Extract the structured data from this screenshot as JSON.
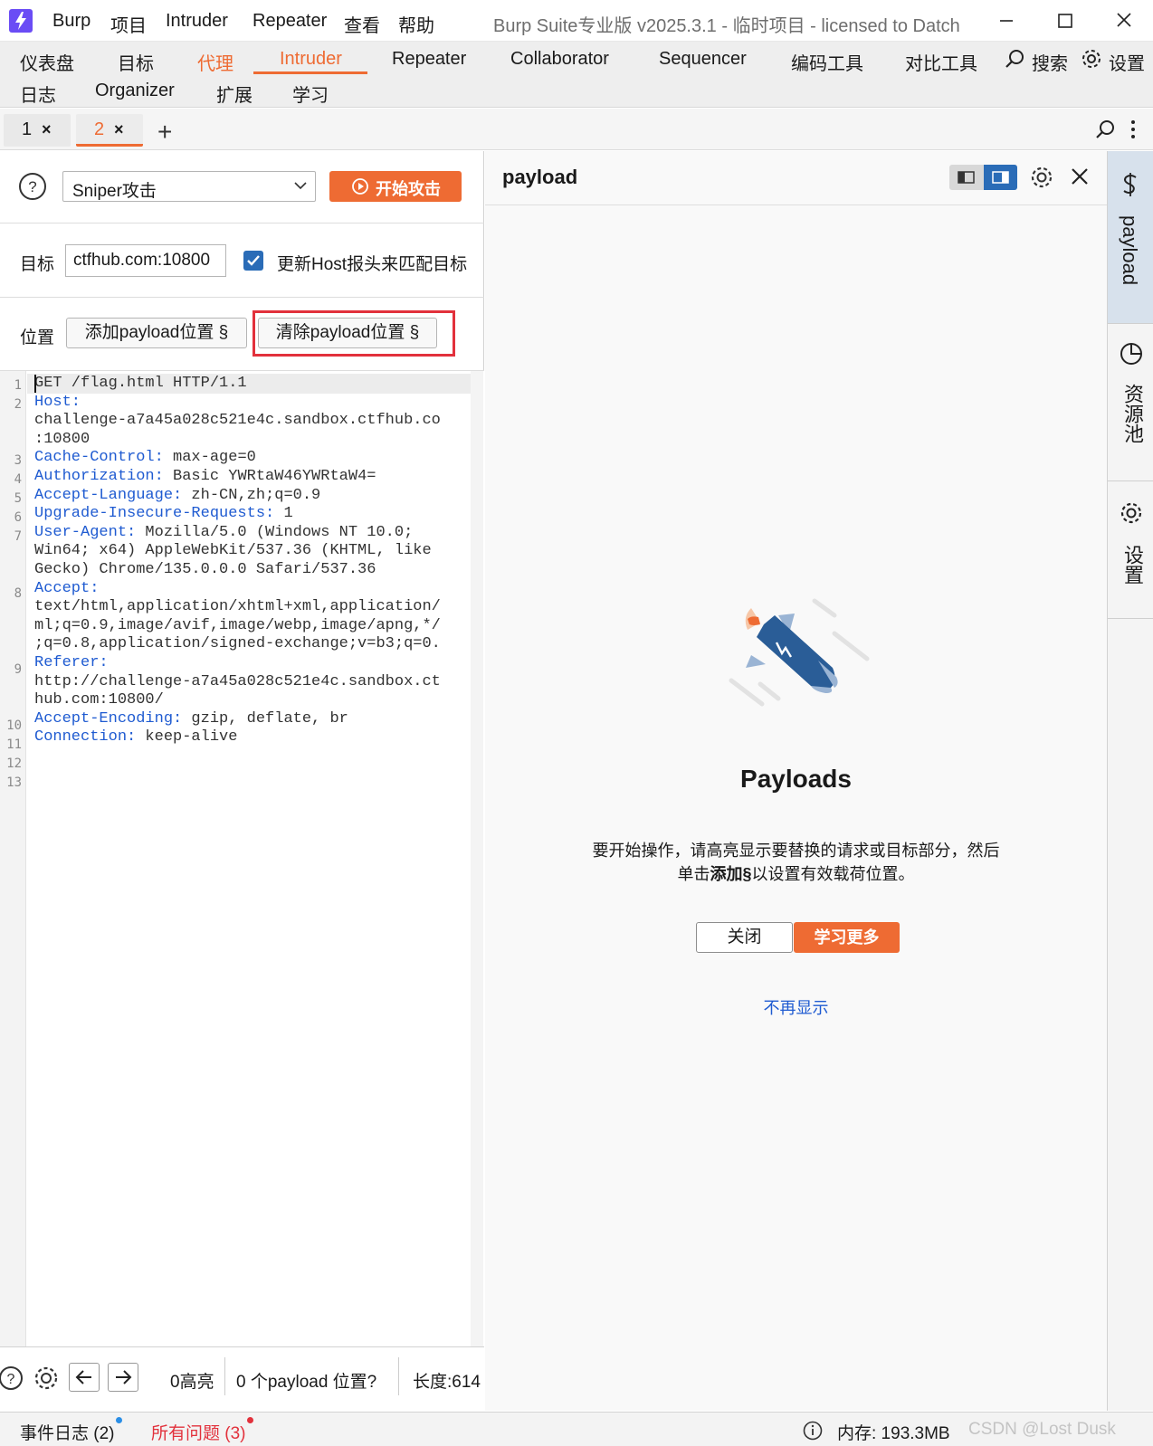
{
  "window": {
    "menu": [
      "Burp",
      "项目",
      "Intruder",
      "Repeater",
      "查看",
      "帮助"
    ],
    "title": "Burp Suite专业版  v2025.3.1 - 临时项目 - licensed to Datch"
  },
  "nav": {
    "row1": [
      "仪表盘",
      "目标",
      "代理",
      "Intruder",
      "Repeater",
      "Collaborator",
      "Sequencer",
      "编码工具",
      "对比工具"
    ],
    "search": "搜索",
    "settings": "设置",
    "row2": [
      "日志",
      "Organizer",
      "扩展",
      "学习"
    ],
    "active": "Intruder",
    "highlighted": "代理"
  },
  "tabs": {
    "items": [
      {
        "label": "1"
      },
      {
        "label": "2"
      }
    ],
    "active_index": 1,
    "add": "+"
  },
  "attack": {
    "type": "Sniper攻击",
    "start_label": "开始攻击"
  },
  "target": {
    "label": "目标",
    "value": "ctfhub.com:10800",
    "update_host_label": "更新Host报头来匹配目标",
    "update_host_checked": true
  },
  "positions": {
    "label": "位置",
    "add_label": "添加payload位置 §",
    "clear_label": "清除payload位置 §"
  },
  "editor": {
    "line_numbers": [
      "1",
      "2",
      "3",
      "4",
      "5",
      "6",
      "7",
      "8",
      "9",
      "10",
      "11",
      "12",
      "13"
    ],
    "lines": [
      {
        "key": "",
        "value": "GET /flag.html HTTP/1.1"
      },
      {
        "key": "Host:",
        "value": ""
      },
      {
        "key": "",
        "value": "challenge-a7a45a028c521e4c.sandbox.ctfhub.co"
      },
      {
        "key": "",
        "value": ":10800"
      },
      {
        "key": "Cache-Control:",
        "value": " max-age=0"
      },
      {
        "key": "Authorization:",
        "value": " Basic YWRtaW46YWRtaW4="
      },
      {
        "key": "Accept-Language:",
        "value": " zh-CN,zh;q=0.9"
      },
      {
        "key": "Upgrade-Insecure-Requests:",
        "value": " 1"
      },
      {
        "key": "User-Agent:",
        "value": " Mozilla/5.0 (Windows NT 10.0;"
      },
      {
        "key": "",
        "value": "Win64; x64) AppleWebKit/537.36 (KHTML, like"
      },
      {
        "key": "",
        "value": "Gecko) Chrome/135.0.0.0 Safari/537.36"
      },
      {
        "key": "Accept:",
        "value": ""
      },
      {
        "key": "",
        "value": "text/html,application/xhtml+xml,application/"
      },
      {
        "key": "",
        "value": "ml;q=0.9,image/avif,image/webp,image/apng,*/"
      },
      {
        "key": "",
        "value": ";q=0.8,application/signed-exchange;v=b3;q=0."
      },
      {
        "key": "Referer:",
        "value": ""
      },
      {
        "key": "",
        "value": "http://challenge-a7a45a028c521e4c.sandbox.ct"
      },
      {
        "key": "",
        "value": "hub.com:10800/"
      },
      {
        "key": "Accept-Encoding:",
        "value": " gzip, deflate, br"
      },
      {
        "key": "Connection:",
        "value": " keep-alive"
      }
    ]
  },
  "editor_footer": {
    "highlight_count": "0高亮",
    "payload_positions": "0 个payload 位置?",
    "length": "长度:614"
  },
  "payload_panel": {
    "title": "payload",
    "heading": "Payloads",
    "desc_line1": "要开始操作，请高亮显示要替换的请求或目标部分，然后",
    "desc_line2_pre": "单击",
    "desc_line2_bold": "添加§",
    "desc_line2_post": "以设置有效载荷位置。",
    "close_label": "关闭",
    "learn_more_label": "学习更多",
    "dont_show_label": "不再显示"
  },
  "right_sidebar": {
    "items": [
      "payload",
      "资源池",
      "设置"
    ]
  },
  "status": {
    "event_log": "事件日志 (2)",
    "all_issues": "所有问题 (3)",
    "memory": "内存: 193.3MB",
    "watermark": "CSDN @Lost Dusk"
  },
  "colors": {
    "accent": "#ee6b33",
    "link": "#1f5bd1",
    "highlight_box": "#e2313c",
    "checkbox": "#2a6cb7"
  }
}
